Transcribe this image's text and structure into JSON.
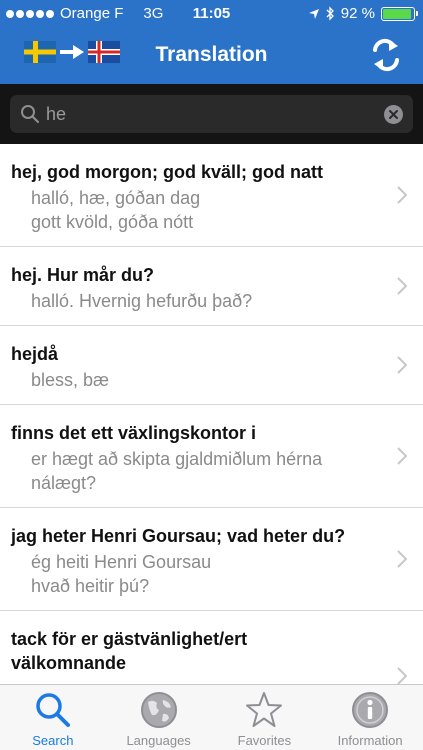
{
  "status": {
    "carrier": "Orange F",
    "network": "3G",
    "time": "11:05",
    "battery": "92 %",
    "battery_level": 0.92
  },
  "nav": {
    "title": "Translation",
    "source_flag": "swedish-flag-icon",
    "target_flag": "icelandic-flag-icon",
    "swap_icon": "swap-arrows-icon"
  },
  "search": {
    "value": "he",
    "placeholder": ""
  },
  "rows": [
    {
      "swedish": "hej, god morgon; god kväll; god natt",
      "icelandic": [
        "halló, hæ, góðan dag",
        "gott kvöld, góða nótt"
      ]
    },
    {
      "swedish": "hej. Hur mår du?",
      "icelandic": [
        "halló. Hvernig hefurðu það?"
      ]
    },
    {
      "swedish": "hejdå",
      "icelandic": [
        "bless, bæ"
      ]
    },
    {
      "swedish": "finns det ett växlingskontor i",
      "icelandic": [
        "er hægt að skipta gjaldmiðlum hérna",
        "nálægt?"
      ]
    },
    {
      "swedish": "jag heter Henri Goursau; vad heter du?",
      "icelandic": [
        "ég heiti Henri Goursau",
        "hvað heitir þú?"
      ]
    },
    {
      "swedish": "tack för er gästvänlighet/ert välkomnande",
      "icelandic": []
    }
  ],
  "tabs": [
    {
      "label": "Search",
      "icon": "search-icon",
      "active": true
    },
    {
      "label": "Languages",
      "icon": "globe-icon",
      "active": false
    },
    {
      "label": "Favorites",
      "icon": "star-icon",
      "active": false
    },
    {
      "label": "Information",
      "icon": "info-icon",
      "active": false
    }
  ],
  "colors": {
    "nav_bg": "#2b73c9",
    "search_bg": "#141414",
    "tab_active": "#1b7ae6",
    "tab_inactive": "#8e8e93"
  }
}
